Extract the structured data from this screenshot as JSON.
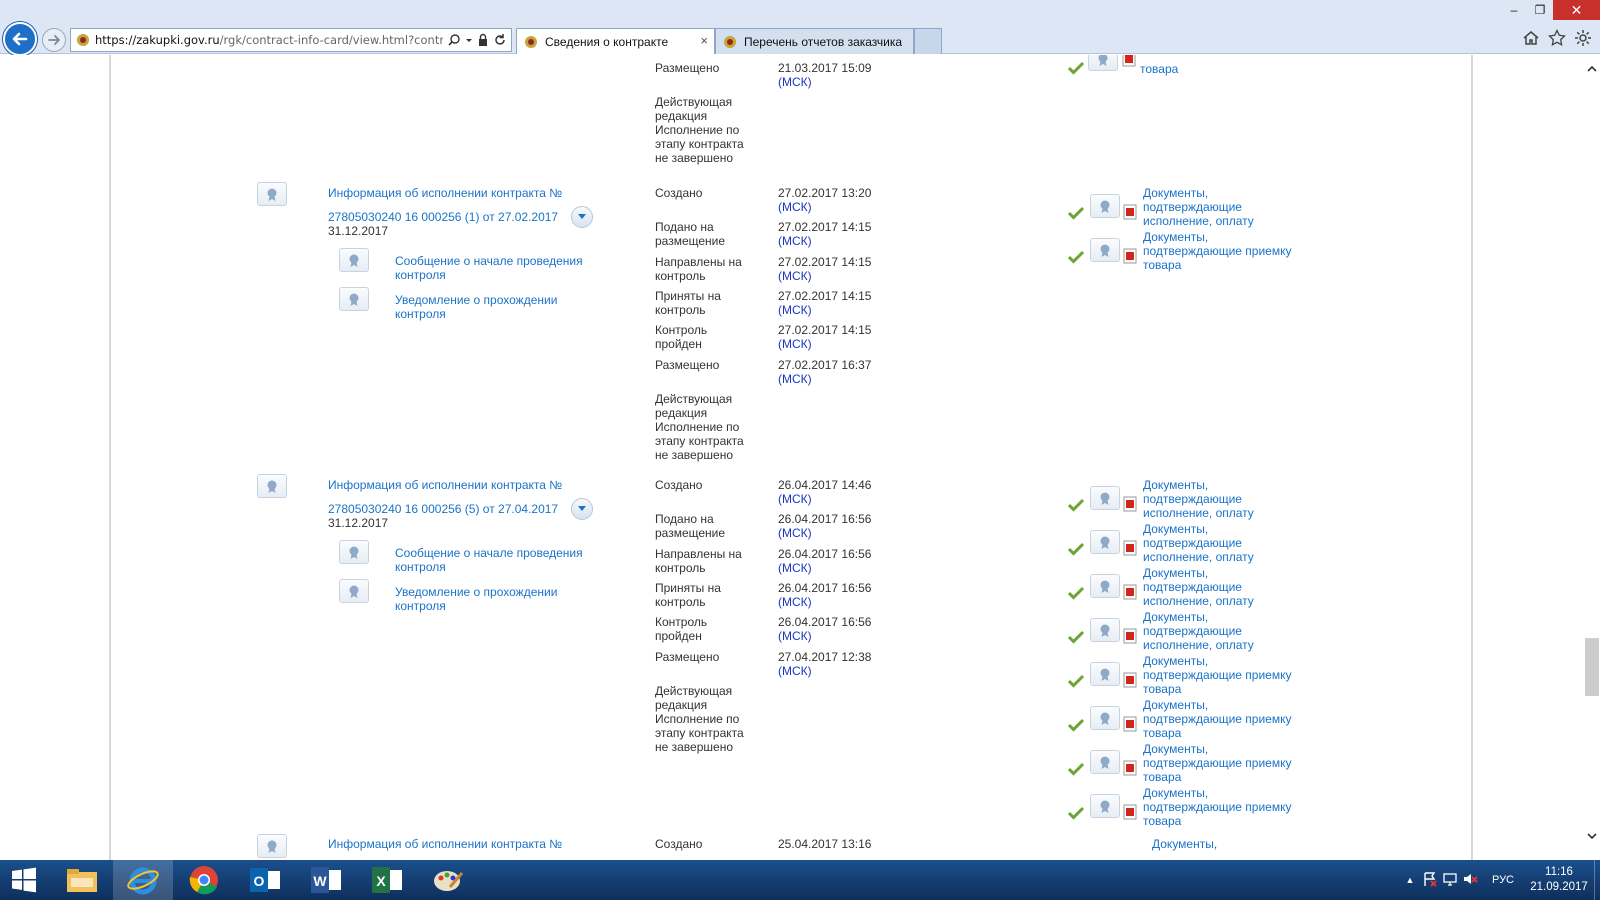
{
  "window": {
    "minimize": "–",
    "restore": "❐",
    "close": "✕"
  },
  "browser": {
    "url_host": "https://zakupki.gov.ru",
    "url_path": "/rgk/contract-info-card/view.html?contrac",
    "tabs": [
      {
        "label": "Сведения о контракте",
        "close": "×"
      },
      {
        "label": "Перечень отчетов заказчика"
      }
    ]
  },
  "colors": {
    "link": "#1a73c8",
    "msk": "#1a35c0",
    "check": "#6aa531",
    "pdf": "#d0261c"
  },
  "top_partial": {
    "rows": [
      {
        "label": "Размещено",
        "date": "21.03.2017 15:09",
        "tz": "(МСК)"
      }
    ],
    "status": [
      "Действующая",
      "редакция",
      "Исполнение по",
      "этапу контракта",
      "не завершено"
    ],
    "doc_tail": "товара"
  },
  "entries": [
    {
      "title_1": "Информация об исполнении контракта №",
      "title_2": "27805030240 16 000256 (1) от 27.02.2017",
      "date": "31.12.2017",
      "subitems": [
        {
          "label_1": "Сообщение о начале проведения",
          "label_2": "контроля"
        },
        {
          "label_1": "Уведомление о прохождении",
          "label_2": "контроля"
        }
      ],
      "events": [
        {
          "label_1": "Создано",
          "label_2": "",
          "date": "27.02.2017 13:20",
          "tz": "(МСК)"
        },
        {
          "label_1": "Подано на",
          "label_2": "размещение",
          "date": "27.02.2017 14:15",
          "tz": "(МСК)"
        },
        {
          "label_1": "Направлены на",
          "label_2": "контроль",
          "date": "27.02.2017 14:15",
          "tz": "(МСК)"
        },
        {
          "label_1": "Приняты на",
          "label_2": "контроль",
          "date": "27.02.2017 14:15",
          "tz": "(МСК)"
        },
        {
          "label_1": "Контроль",
          "label_2": "пройден",
          "date": "27.02.2017 14:15",
          "tz": "(МСК)"
        },
        {
          "label_1": "Размещено",
          "label_2": "",
          "date": "27.02.2017 16:37",
          "tz": "(МСК)"
        }
      ],
      "status": [
        "Действующая",
        "редакция",
        "Исполнение по",
        "этапу контракта",
        "не завершено"
      ],
      "docs": [
        [
          "Документы,",
          "подтверждающие",
          "исполнение, оплату"
        ],
        [
          "Документы,",
          "подтверждающие приемку",
          "товара"
        ]
      ]
    },
    {
      "title_1": "Информация об исполнении контракта №",
      "title_2": "27805030240 16 000256 (5) от 27.04.2017",
      "date": "31.12.2017",
      "subitems": [
        {
          "label_1": "Сообщение о начале проведения",
          "label_2": "контроля"
        },
        {
          "label_1": "Уведомление о прохождении",
          "label_2": "контроля"
        }
      ],
      "events": [
        {
          "label_1": "Создано",
          "label_2": "",
          "date": "26.04.2017 14:46",
          "tz": "(МСК)"
        },
        {
          "label_1": "Подано на",
          "label_2": "размещение",
          "date": "26.04.2017 16:56",
          "tz": "(МСК)"
        },
        {
          "label_1": "Направлены на",
          "label_2": "контроль",
          "date": "26.04.2017 16:56",
          "tz": "(МСК)"
        },
        {
          "label_1": "Приняты на",
          "label_2": "контроль",
          "date": "26.04.2017 16:56",
          "tz": "(МСК)"
        },
        {
          "label_1": "Контроль",
          "label_2": "пройден",
          "date": "26.04.2017 16:56",
          "tz": "(МСК)"
        },
        {
          "label_1": "Размещено",
          "label_2": "",
          "date": "27.04.2017 12:38",
          "tz": "(МСК)"
        }
      ],
      "status": [
        "Действующая",
        "редакция",
        "Исполнение по",
        "этапу контракта",
        "не завершено"
      ],
      "docs": [
        [
          "Документы,",
          "подтверждающие",
          "исполнение, оплату"
        ],
        [
          "Документы,",
          "подтверждающие",
          "исполнение, оплату"
        ],
        [
          "Документы,",
          "подтверждающие",
          "исполнение, оплату"
        ],
        [
          "Документы,",
          "подтверждающие",
          "исполнение, оплату"
        ],
        [
          "Документы,",
          "подтверждающие приемку",
          "товара"
        ],
        [
          "Документы,",
          "подтверждающие приемку",
          "товара"
        ],
        [
          "Документы,",
          "подтверждающие приемку",
          "товара"
        ],
        [
          "Документы,",
          "подтверждающие приемку",
          "товара"
        ]
      ]
    }
  ],
  "bottom_partial": {
    "title_1": "Информация об исполнении контракта №",
    "event_label": "Создано",
    "event_date": "25.04.2017 13:16",
    "doc_head": "Документы,"
  },
  "taskbar": {
    "apps": [
      "start-icon",
      "file-explorer-icon",
      "internet-explorer-icon",
      "chrome-icon",
      "outlook-icon",
      "word-icon",
      "excel-icon",
      "paint-icon"
    ],
    "tray_chevron": "▲",
    "lang": "РУС",
    "time": "11:16",
    "date": "21.09.2017"
  }
}
